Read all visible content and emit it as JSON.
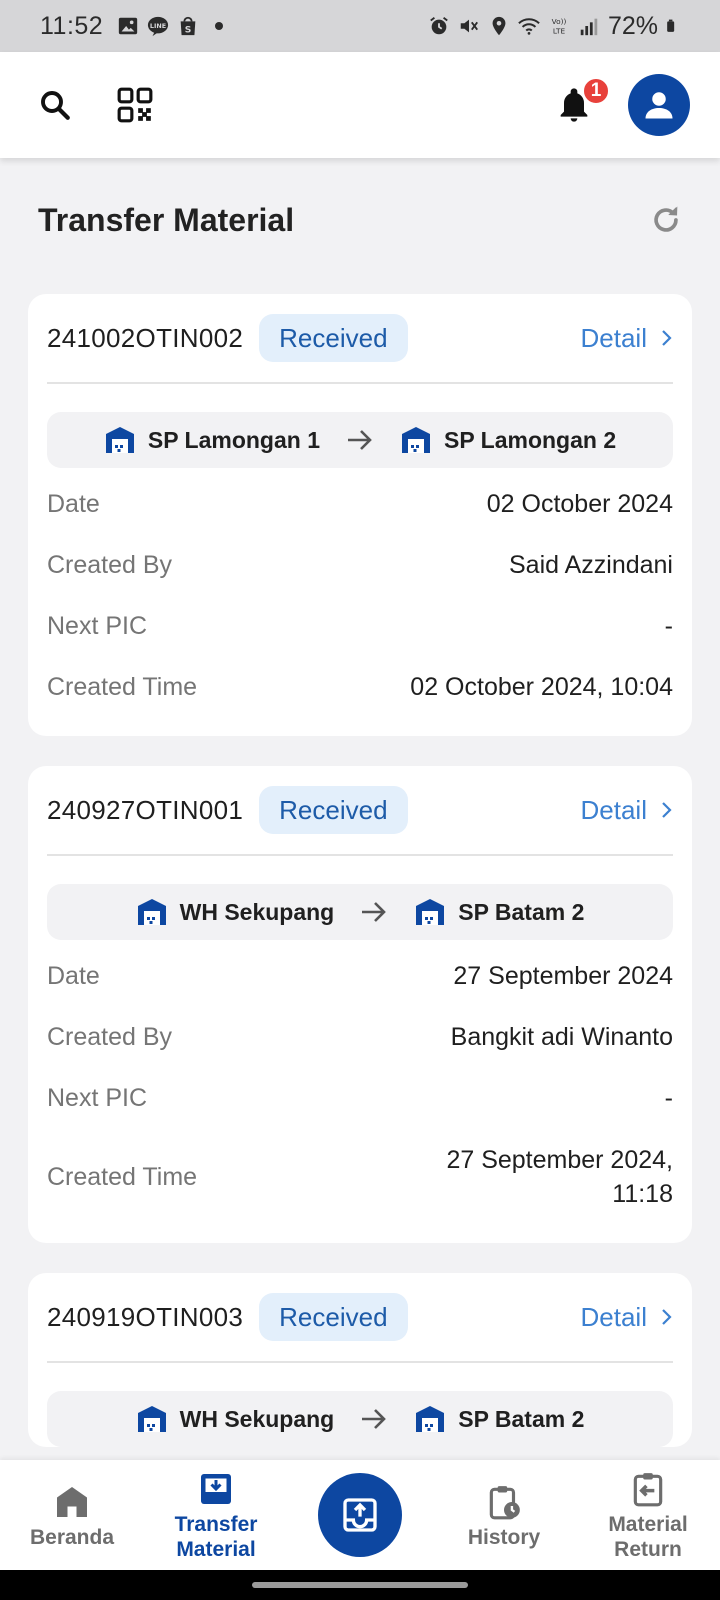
{
  "status_bar": {
    "time": "11:52",
    "battery": "72%",
    "left_icons": [
      "image-icon",
      "line-icon",
      "shopee-icon"
    ],
    "right_icons": [
      "alarm-icon",
      "mute-icon",
      "location-icon",
      "wifi-icon",
      "volte-icon",
      "signal-icon",
      "battery-icon"
    ]
  },
  "app_bar": {
    "notification_count": "1",
    "icons": [
      "search-icon",
      "qr-code-icon",
      "bell-icon",
      "user-icon"
    ]
  },
  "page": {
    "title": "Transfer Material"
  },
  "labels": {
    "date": "Date",
    "created_by": "Created By",
    "next_pic": "Next PIC",
    "created_time": "Created Time",
    "detail": "Detail"
  },
  "cards": [
    {
      "id": "241002OTIN002",
      "status": "Received",
      "from": "SP Lamongan 1",
      "to": "SP Lamongan 2",
      "date": "02 October 2024",
      "created_by": "Said Azzindani",
      "next_pic": "-",
      "created_time": "02 October 2024, 10:04"
    },
    {
      "id": "240927OTIN001",
      "status": "Received",
      "from": "WH Sekupang",
      "to": "SP Batam 2",
      "date": "27 September 2024",
      "created_by": "Bangkit adi Winanto",
      "next_pic": "-",
      "created_time": "27 September 2024, 11:18"
    },
    {
      "id": "240919OTIN003",
      "status": "Received",
      "from": "WH Sekupang",
      "to": "SP Batam 2"
    }
  ],
  "bottom_nav": {
    "beranda": "Beranda",
    "transfer_material": "Transfer Material",
    "history": "History",
    "material_return": "Material Return"
  },
  "colors": {
    "primary": "#0d47a1",
    "status_bg": "#e3effb",
    "status_text": "#1d5ba8",
    "detail_link": "#3c80d0",
    "badge": "#e8413b",
    "background": "#f2f2f4"
  }
}
